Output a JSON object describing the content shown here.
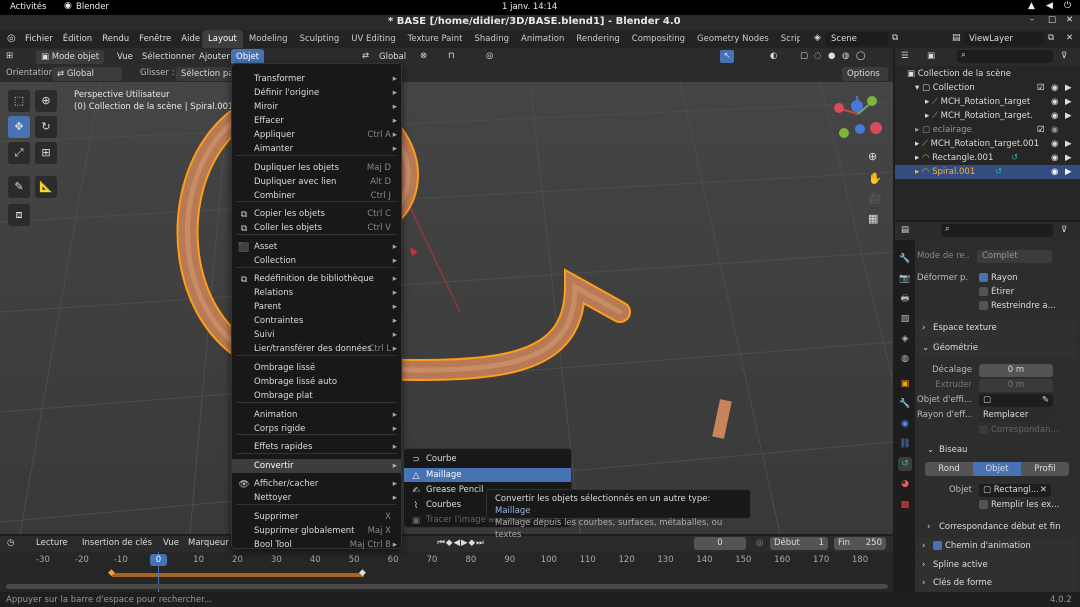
{
  "gnome": {
    "activities": "Activités",
    "app": "Blender",
    "clock": "1 janv.  14:14"
  },
  "window": {
    "title": "* BASE [/home/didier/3D/BASE.blend1] - Blender 4.0"
  },
  "menubar": {
    "items": [
      "Fichier",
      "Édition",
      "Rendu",
      "Fenêtre",
      "Aide"
    ]
  },
  "workspaces": {
    "tabs": [
      "Layout",
      "Modeling",
      "Sculpting",
      "UV Editing",
      "Texture Paint",
      "Shading",
      "Animation",
      "Rendering",
      "Compositing",
      "Geometry Nodes",
      "Scripting"
    ],
    "active": "Layout",
    "add": "+"
  },
  "scene": {
    "label": "Scene",
    "viewlayer": "ViewLayer"
  },
  "header3d": {
    "mode": "Mode objet",
    "menus": [
      "Vue",
      "Sélectionner",
      "Ajouter",
      "Objet"
    ],
    "transform": "Global"
  },
  "toolhdr": {
    "orientation_label": "Orientation:",
    "orientation_value": "Global",
    "drag_label": "Glisser :",
    "drag_value": "Sélection par",
    "options": "Options"
  },
  "viewport": {
    "view_name": "Perspective Utilisateur",
    "collection_info": "(0) Collection de la scène | Spiral.001"
  },
  "objmenu": {
    "items": [
      {
        "label": "Transformer",
        "sub": true
      },
      {
        "label": "Définir l'origine",
        "sub": true
      },
      {
        "label": "Miroir",
        "sub": true
      },
      {
        "label": "Effacer",
        "sub": true
      },
      {
        "label": "Appliquer",
        "sc": "Ctrl A",
        "sub": true
      },
      {
        "label": "Aimanter",
        "sub": true
      },
      {
        "label": "Dupliquer les objets",
        "sc": "Maj D"
      },
      {
        "label": "Dupliquer avec lien",
        "sc": "Alt D"
      },
      {
        "label": "Combiner",
        "sc": "Ctrl J"
      },
      {
        "label": "Copier les objets",
        "sc": "Ctrl C"
      },
      {
        "label": "Coller les objets",
        "sc": "Ctrl V"
      },
      {
        "label": "Asset",
        "sub": true
      },
      {
        "label": "Collection",
        "sub": true
      },
      {
        "label": "Redéfinition de bibliothèque",
        "sub": true
      },
      {
        "label": "Relations",
        "sub": true
      },
      {
        "label": "Parent",
        "sub": true
      },
      {
        "label": "Contraintes",
        "sub": true
      },
      {
        "label": "Suivi",
        "sub": true
      },
      {
        "label": "Lier/transférer des données",
        "sc": "Ctrl L",
        "sub": true
      },
      {
        "label": "Ombrage lissé"
      },
      {
        "label": "Ombrage lissé auto"
      },
      {
        "label": "Ombrage plat"
      },
      {
        "label": "Animation",
        "sub": true
      },
      {
        "label": "Corps rigide",
        "sub": true
      },
      {
        "label": "Effets rapides",
        "sub": true
      },
      {
        "label": "Convertir",
        "sub": true
      },
      {
        "label": "Afficher/cacher",
        "sub": true
      },
      {
        "label": "Nettoyer",
        "sub": true
      },
      {
        "label": "Supprimer",
        "sc": "X"
      },
      {
        "label": "Supprimer globalement",
        "sc": "Maj X"
      },
      {
        "label": "Bool Tool",
        "sc": "Maj Ctrl B",
        "sub": true
      }
    ]
  },
  "convert": {
    "items": [
      "Courbe",
      "Maillage",
      "Grease Pencil",
      "Courbes",
      "Tracer l'image au Grease Pencil"
    ]
  },
  "tooltip": {
    "line1_prefix": "Convertir les objets sélectionnés en un autre type:",
    "line1_value": "Maillage",
    "line2": "Maillage depuis les courbes, surfaces, métaballes, ou textes"
  },
  "outliner": {
    "root": "Collection de la scène",
    "items": [
      "Collection",
      "MCH_Rotation_target",
      "MCH_Rotation_target.",
      "eclairage",
      "MCH_Rotation_target.001",
      "Rectangle.001",
      "Spiral.001"
    ]
  },
  "props": {
    "mode_label": "Mode de re...",
    "mode_value": "Complet",
    "deform_label": "Déformer p...",
    "rayon": "Rayon",
    "etirer": "Étirer",
    "restreindre": "Restreindre a...",
    "espace_texture": "Espace texture",
    "geometrie": "Géométrie",
    "decalage_label": "Décalage",
    "decalage_value": "0 m",
    "extruder_label": "Extruder",
    "extruder_value": "0 m",
    "objeff_label": "Objet d'effi...",
    "rayoneff_label": "Rayon d'eff...",
    "rayoneff_value": "Remplacer",
    "correspondance": "Correspondan...",
    "biseau": "Biseau",
    "biseau_tabs": [
      "Rond",
      "Objet",
      "Profil"
    ],
    "biseau_active": "Objet",
    "objet_label": "Objet",
    "objet_value": "Rectangl...",
    "remplir": "Remplir les ex...",
    "corresp_debut": "Correspondance début et fin",
    "chemin": "Chemin d'animation",
    "spline": "Spline active",
    "cles": "Clés de forme"
  },
  "timeline": {
    "menus": [
      "Lecture",
      "Insertion de clés",
      "Vue",
      "Marqueur"
    ],
    "frame": "0",
    "debut_label": "Début",
    "debut": "1",
    "fin_label": "Fin",
    "fin": "250",
    "ticks": [
      "-30",
      "-20",
      "-10",
      "0",
      "10",
      "20",
      "30",
      "40",
      "50",
      "60",
      "70",
      "80",
      "90",
      "100",
      "110",
      "120",
      "130",
      "140",
      "150",
      "160",
      "170",
      "180"
    ],
    "current": "0"
  },
  "status": {
    "hint": "Appuyer sur la barre d'espace pour rechercher...",
    "version": "4.0.2"
  },
  "colors": {
    "accent": "#4772b3",
    "orange": "#ff9d1a",
    "copper": "#b87a55"
  }
}
